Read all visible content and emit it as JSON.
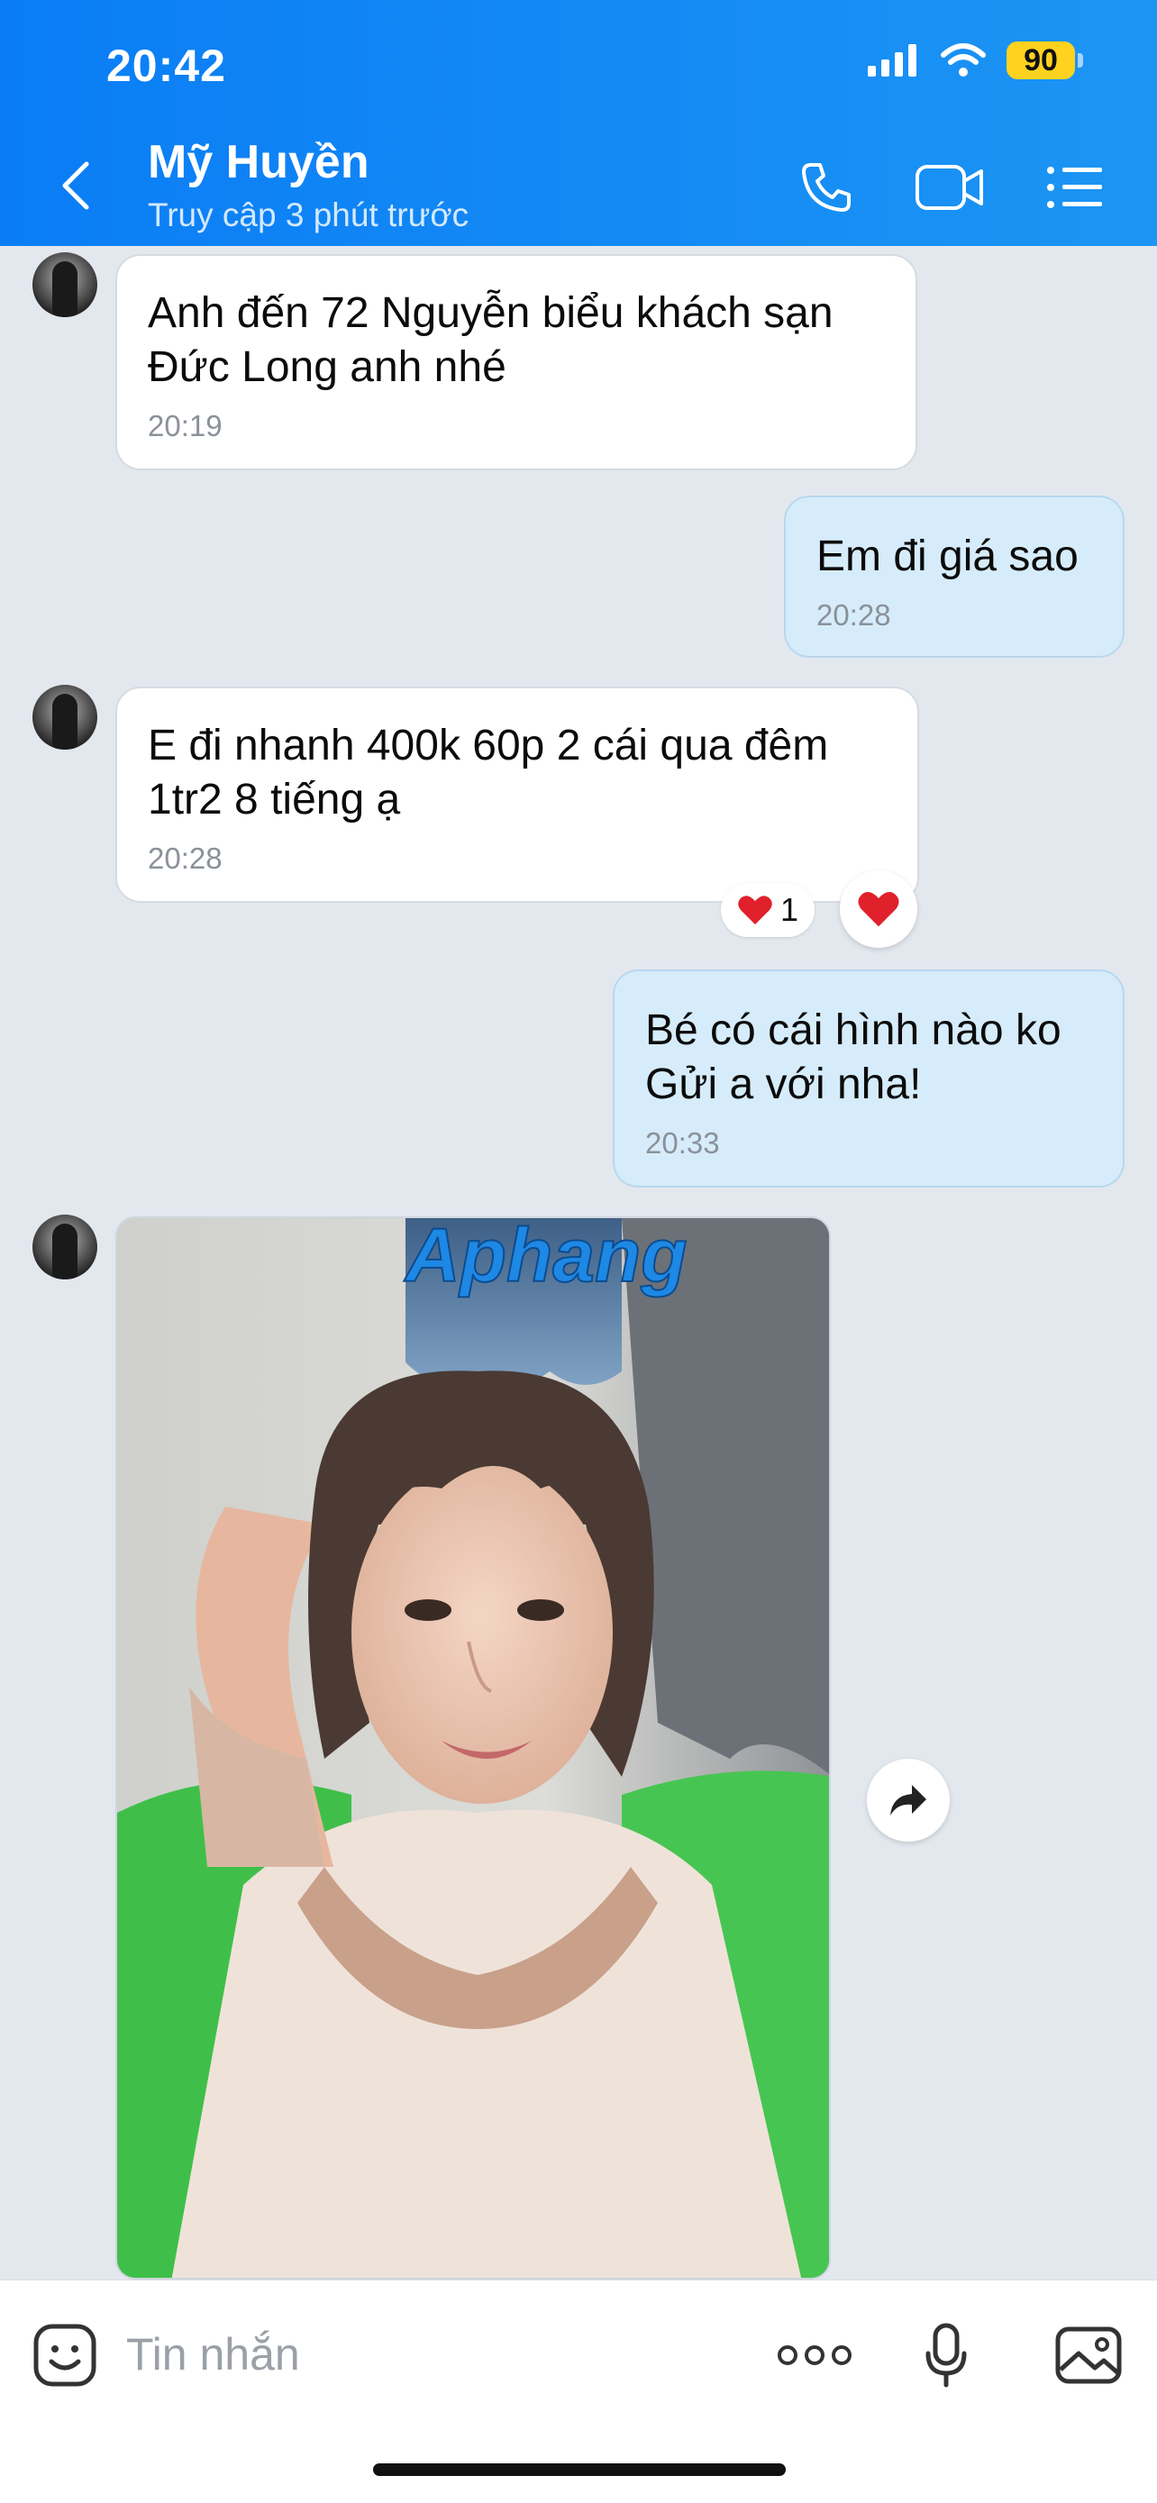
{
  "status_bar": {
    "time": "20:42",
    "battery": "90"
  },
  "header": {
    "name": "Mỹ Huyền",
    "status": "Truy cập 3 phút trước"
  },
  "messages": [
    {
      "dir": "in",
      "text": "Anh đến 72 Nguyễn biểu khách sạn\nĐức Long anh nhé",
      "time": "20:19"
    },
    {
      "dir": "out",
      "text": "Em đi giá sao",
      "time": "20:28"
    },
    {
      "dir": "in",
      "text": "E đi nhanh 400k 60p 2 cái qua đêm\n1tr2 8 tiếng ạ",
      "time": "20:28"
    },
    {
      "dir": "out",
      "text": "Bé có cái hình nào ko\nGửi a với nha!",
      "time": "20:33"
    }
  ],
  "reaction": {
    "count": "1"
  },
  "photo": {
    "watermark": "Aphang"
  },
  "input": {
    "placeholder": "Tin nhắn"
  },
  "colors": {
    "header": "#0a7df5",
    "outgoing_bubble": "#d6ecfa",
    "incoming_bubble": "#ffffff",
    "heart": "#e0202a"
  },
  "icons": [
    "back-icon",
    "phone-icon",
    "video-icon",
    "menu-icon",
    "heart-icon",
    "share-icon",
    "sticker-icon",
    "more-icon",
    "mic-icon",
    "image-icon",
    "signal-icon",
    "wifi-icon"
  ]
}
